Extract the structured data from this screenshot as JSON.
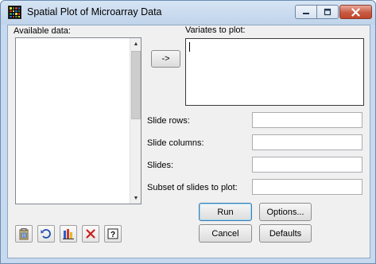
{
  "window": {
    "title": "Spatial Plot of Microarray Data"
  },
  "available_data": {
    "label": "Available data:",
    "items": []
  },
  "variates": {
    "label": "Variates to plot:",
    "value": "",
    "add_button_label": "->"
  },
  "fields": {
    "slide_rows": {
      "label": "Slide rows:",
      "value": ""
    },
    "slide_columns": {
      "label": "Slide columns:",
      "value": ""
    },
    "slides": {
      "label": "Slides:",
      "value": ""
    },
    "subset": {
      "label": "Subset of slides to plot:",
      "value": ""
    }
  },
  "buttons": {
    "run": "Run",
    "options": "Options...",
    "cancel": "Cancel",
    "defaults": "Defaults"
  },
  "toolbar_icons": [
    "spreadsheet-paste-icon",
    "restore-icon",
    "save-icon",
    "clear-icon",
    "help-icon"
  ],
  "colors": {
    "frame": "#c6d9ee",
    "client": "#f0f0f0",
    "close_button": "#c85a43",
    "default_button_border": "#3c7fb1"
  }
}
